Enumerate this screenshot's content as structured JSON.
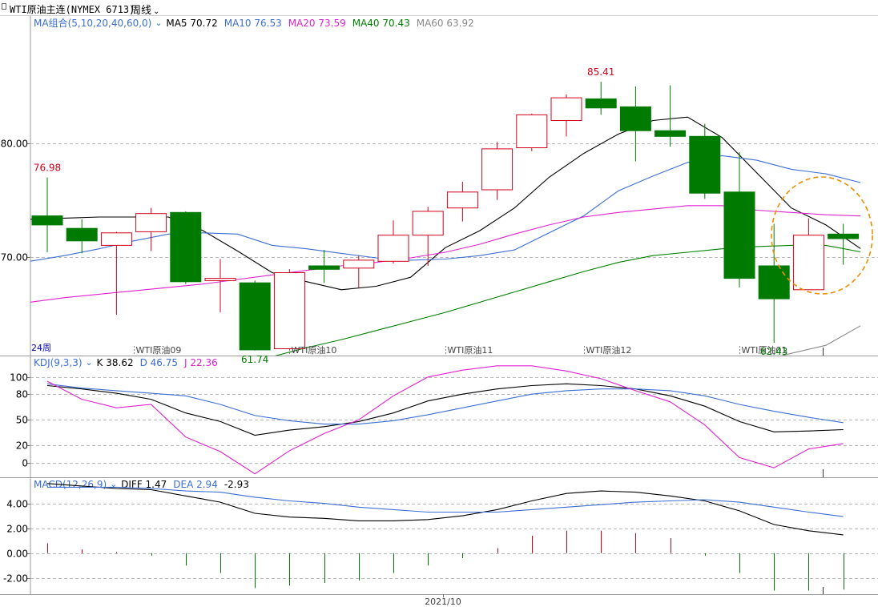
{
  "header": {
    "symbol_title": "WTI原油主连(NYMEX 6713)",
    "period_label": "周线"
  },
  "colors": {
    "up": "#d0021b",
    "down": "#007a00",
    "ma5": "#000000",
    "ma10": "#3b6fd4",
    "ma20": "#e020d0",
    "ma40": "#008000",
    "ma60": "#888888",
    "kdj_k": "#000000",
    "kdj_d": "#3b6fd4",
    "kdj_j": "#e020d0",
    "macd_diff": "#000000",
    "macd_dea": "#3b6fd4",
    "macd_hist_pos": "#d0021b",
    "macd_hist_neg": "#007a00",
    "annotation_circle": "#f08c00",
    "grid": "#b8b8b8",
    "axis_text": "#000000"
  },
  "price_panel": {
    "legend_prefix": "MA组合(5,10,20,40,60,0)",
    "legend_items": [
      {
        "label": "MA5 70.72",
        "color_key": "ma5"
      },
      {
        "label": "MA10 76.53",
        "color_key": "ma10"
      },
      {
        "label": "MA20 73.59",
        "color_key": "ma20"
      },
      {
        "label": "MA40 70.43",
        "color_key": "ma40"
      },
      {
        "label": "MA60 63.92",
        "color_key": "ma60"
      }
    ],
    "y_ticks": [
      "80.00",
      "70.00"
    ],
    "period_tag": "24周",
    "period_separators": [
      "WTI原油09",
      "WTI原油10",
      "WTI原油11",
      "WTI原油12",
      "WTI原油01"
    ],
    "annotations": [
      {
        "text": "85.41",
        "candle_index": 16,
        "at": "high",
        "color_key": "up"
      },
      {
        "text": "76.98",
        "candle_index": 0,
        "at": "high",
        "color_key": "up"
      },
      {
        "text": "62.43",
        "candle_index": 21,
        "at": "low",
        "color_key": "down"
      },
      {
        "text": "61.74",
        "candle_index": 6,
        "at": "low",
        "color_key": "down"
      }
    ]
  },
  "kdj_panel": {
    "legend_prefix": "KDJ(9,3,3)",
    "legend_items": [
      {
        "label": "K 38.62",
        "color_key": "kdj_k"
      },
      {
        "label": "D 46.75",
        "color_key": "kdj_d"
      },
      {
        "label": "J 22.36",
        "color_key": "kdj_j"
      }
    ],
    "y_ticks": [
      "100",
      "80",
      "50",
      "20",
      "0"
    ]
  },
  "macd_panel": {
    "legend_prefix": "MACD(12,26,9)",
    "legend_items": [
      {
        "label": "DIFF 1.47",
        "color_key": "macd_diff"
      },
      {
        "label": "DEA 2.94",
        "color_key": "macd_dea"
      },
      {
        "label": "-2.93",
        "color_key": "macd_diff"
      }
    ],
    "y_ticks": [
      "4.00",
      "2.00",
      "0.00",
      "-2.00"
    ]
  },
  "x_axis": {
    "date_label": "2021/10"
  },
  "chart_data": [
    {
      "type": "candlestick",
      "title": "",
      "ylim": [
        61.3,
        91.2
      ],
      "grid": true,
      "candles": [
        {
          "o": 73.6,
          "c": 72.8,
          "h": 76.98,
          "l": 70.4
        },
        {
          "o": 72.5,
          "c": 71.4,
          "h": 73.3,
          "l": 70.3
        },
        {
          "o": 71.0,
          "c": 72.1,
          "h": 72.2,
          "l": 64.9
        },
        {
          "o": 72.2,
          "c": 73.8,
          "h": 74.3,
          "l": 70.5
        },
        {
          "o": 73.9,
          "c": 67.8,
          "h": 74.0,
          "l": 67.6
        },
        {
          "o": 67.9,
          "c": 68.1,
          "h": 69.8,
          "l": 65.1
        },
        {
          "o": 67.7,
          "c": 61.8,
          "h": 67.9,
          "l": 61.74
        },
        {
          "o": 61.9,
          "c": 68.6,
          "h": 68.9,
          "l": 61.8
        },
        {
          "o": 69.2,
          "c": 68.9,
          "h": 70.6,
          "l": 67.7
        },
        {
          "o": 69.0,
          "c": 69.7,
          "h": 70.1,
          "l": 67.3
        },
        {
          "o": 69.6,
          "c": 71.9,
          "h": 73.2,
          "l": 69.4
        },
        {
          "o": 71.9,
          "c": 74.0,
          "h": 74.4,
          "l": 69.2
        },
        {
          "o": 74.3,
          "c": 75.7,
          "h": 76.6,
          "l": 73.1
        },
        {
          "o": 75.9,
          "c": 79.5,
          "h": 80.1,
          "l": 75.0
        },
        {
          "o": 79.6,
          "c": 82.5,
          "h": 82.6,
          "l": 79.3
        },
        {
          "o": 82.0,
          "c": 84.0,
          "h": 84.3,
          "l": 80.6
        },
        {
          "o": 83.9,
          "c": 83.1,
          "h": 85.41,
          "l": 82.5
        },
        {
          "o": 83.2,
          "c": 81.1,
          "h": 85.0,
          "l": 78.4
        },
        {
          "o": 81.1,
          "c": 80.6,
          "h": 85.1,
          "l": 79.7
        },
        {
          "o": 80.6,
          "c": 75.6,
          "h": 81.7,
          "l": 75.1
        },
        {
          "o": 75.7,
          "c": 68.1,
          "h": 79.2,
          "l": 67.3
        },
        {
          "o": 69.2,
          "c": 66.3,
          "h": 72.9,
          "l": 62.43
        },
        {
          "o": 67.1,
          "c": 71.9,
          "h": 73.4,
          "l": 67.1
        },
        {
          "o": 72.0,
          "c": 71.6,
          "h": 72.9,
          "l": 69.3
        }
      ],
      "series": [
        {
          "name": "MA5",
          "color_key": "ma5",
          "values": [
            73.3,
            73.4,
            73.5,
            73.5,
            73.5,
            72.3,
            70.5,
            68.6,
            67.8,
            67.1,
            67.4,
            68.2,
            70.8,
            72.3,
            74.3,
            77.0,
            79.1,
            80.8,
            82.0,
            82.3,
            80.5,
            77.4,
            74.3,
            72.8,
            70.72
          ]
        },
        {
          "name": "MA10",
          "color_key": "ma10",
          "values": [
            69.6,
            70.1,
            70.7,
            71.4,
            72.0,
            72.1,
            72.0,
            71.0,
            70.7,
            70.3,
            69.9,
            69.7,
            69.8,
            70.1,
            70.6,
            72.1,
            73.6,
            75.8,
            77.1,
            78.3,
            78.9,
            78.5,
            77.7,
            77.3,
            76.53
          ]
        },
        {
          "name": "MA20",
          "color_key": "ma20",
          "values": [
            66.0,
            66.4,
            66.7,
            67.0,
            67.3,
            67.6,
            68.0,
            68.4,
            68.8,
            69.2,
            69.5,
            69.9,
            70.4,
            71.1,
            72.0,
            72.8,
            73.5,
            73.9,
            74.2,
            74.5,
            74.5,
            74.1,
            73.9,
            73.7,
            73.59
          ]
        },
        {
          "name": "MA40",
          "color_key": "ma40",
          "values": [
            null,
            null,
            null,
            null,
            null,
            59.3,
            60.3,
            61.2,
            62.0,
            62.7,
            63.5,
            64.3,
            65.1,
            66.0,
            66.9,
            67.8,
            68.7,
            69.5,
            70.1,
            70.4,
            70.7,
            70.9,
            71.0,
            71.0,
            70.43
          ]
        },
        {
          "name": "MA60",
          "color_key": "ma60",
          "values": [
            null,
            null,
            null,
            null,
            null,
            null,
            null,
            null,
            null,
            null,
            null,
            null,
            null,
            null,
            null,
            null,
            null,
            null,
            57.6,
            58.7,
            59.7,
            60.7,
            61.5,
            62.2,
            63.92
          ]
        }
      ]
    },
    {
      "type": "line",
      "title": "",
      "ylim": [
        -17,
        125
      ],
      "grid": true,
      "series": [
        {
          "name": "K",
          "color_key": "kdj_k",
          "values": [
            90,
            86,
            81,
            74,
            58,
            48,
            32,
            38,
            42,
            48,
            58,
            72,
            80,
            86,
            90,
            92,
            90,
            86,
            78,
            66,
            48,
            36,
            37,
            38.62
          ]
        },
        {
          "name": "D",
          "color_key": "kdj_d",
          "values": [
            92,
            87,
            84,
            81,
            78,
            68,
            55,
            49,
            45,
            45,
            49,
            56,
            64,
            72,
            80,
            84,
            86,
            86,
            84,
            78,
            68,
            60,
            53,
            46.75
          ]
        },
        {
          "name": "J",
          "color_key": "kdj_j",
          "values": [
            95,
            74,
            64,
            68,
            30,
            13,
            -13,
            14,
            34,
            50,
            78,
            100,
            108,
            113,
            113,
            107,
            98,
            84,
            71,
            44,
            6,
            -6,
            16,
            22.36
          ]
        }
      ]
    },
    {
      "type": "line",
      "title": "",
      "ylim": [
        -3.3,
        6.1
      ],
      "grid": true,
      "series": [
        {
          "name": "DIFF",
          "color_key": "macd_diff",
          "values": [
            5.6,
            5.4,
            5.2,
            5.1,
            4.6,
            4.1,
            3.2,
            2.9,
            2.8,
            2.6,
            2.6,
            2.7,
            3.0,
            3.5,
            4.2,
            4.8,
            5.0,
            4.9,
            4.6,
            4.2,
            3.4,
            2.3,
            1.8,
            1.47
          ]
        },
        {
          "name": "DEA",
          "color_key": "macd_dea",
          "values": [
            5.3,
            5.3,
            5.3,
            5.2,
            5.0,
            4.9,
            4.5,
            4.2,
            4.0,
            3.7,
            3.5,
            3.3,
            3.3,
            3.3,
            3.5,
            3.7,
            3.9,
            4.1,
            4.2,
            4.3,
            4.1,
            3.7,
            3.3,
            2.94
          ]
        },
        {
          "name": "MACD",
          "color_key": "macd_hist_pos",
          "bars": [
            0.8,
            0.3,
            0.1,
            -0.2,
            -1.0,
            -1.6,
            -2.8,
            -2.6,
            -2.4,
            -2.2,
            -1.6,
            -1.0,
            -0.4,
            0.4,
            1.4,
            1.8,
            1.8,
            1.6,
            1.2,
            -0.2,
            -1.6,
            -3.0,
            -3.0,
            -2.93
          ]
        }
      ]
    }
  ]
}
